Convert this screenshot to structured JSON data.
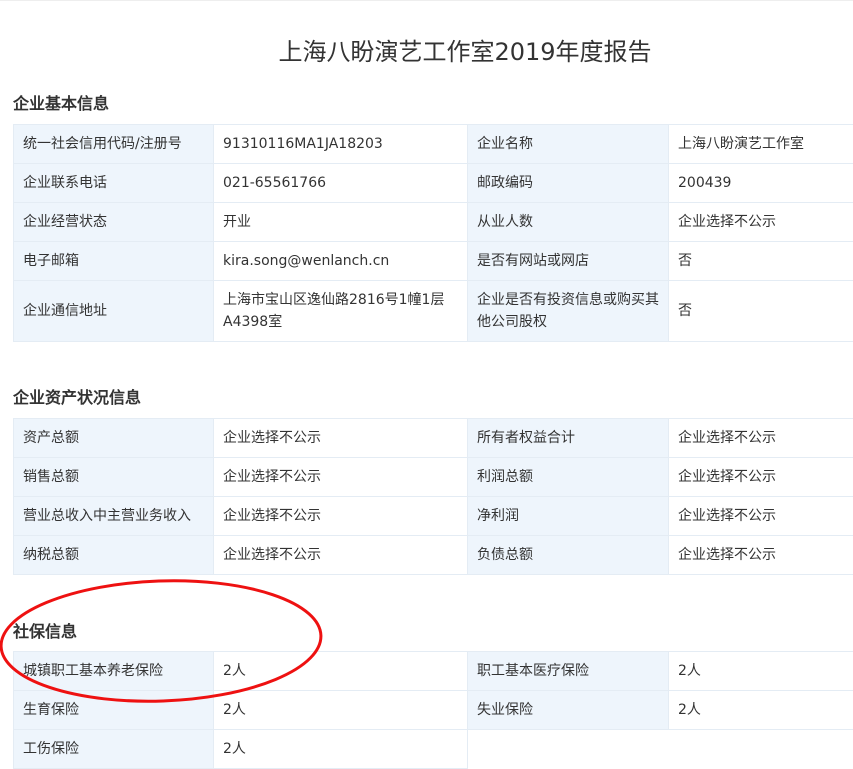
{
  "title": "上海八盼演艺工作室2019年度报告",
  "basic": {
    "heading": "企业基本信息",
    "rows": [
      [
        "统一社会信用代码/注册号",
        "91310116MA1JA18203",
        "企业名称",
        "上海八盼演艺工作室"
      ],
      [
        "企业联系电话",
        "021-65561766",
        "邮政编码",
        "200439"
      ],
      [
        "企业经营状态",
        "开业",
        "从业人数",
        "企业选择不公示"
      ],
      [
        "电子邮箱",
        "kira.song@wenlanch.cn",
        "是否有网站或网店",
        "否"
      ],
      [
        "企业通信地址",
        "上海市宝山区逸仙路2816号1幢1层A4398室",
        "企业是否有投资信息或购买其他公司股权",
        "否"
      ]
    ]
  },
  "assets": {
    "heading": "企业资产状况信息",
    "rows": [
      [
        "资产总额",
        "企业选择不公示",
        "所有者权益合计",
        "企业选择不公示"
      ],
      [
        "销售总额",
        "企业选择不公示",
        "利润总额",
        "企业选择不公示"
      ],
      [
        "营业总收入中主营业务收入",
        "企业选择不公示",
        "净利润",
        "企业选择不公示"
      ],
      [
        "纳税总额",
        "企业选择不公示",
        "负债总额",
        "企业选择不公示"
      ]
    ]
  },
  "social": {
    "heading": "社保信息",
    "rows": [
      [
        "城镇职工基本养老保险",
        "2人",
        "职工基本医疗保险",
        "2人"
      ],
      [
        "生育保险",
        "2人",
        "失业保险",
        "2人"
      ],
      [
        "工伤保险",
        "2人"
      ]
    ]
  },
  "colors": {
    "annotation": "#ee1111",
    "label_bg": "#eef5fc"
  }
}
